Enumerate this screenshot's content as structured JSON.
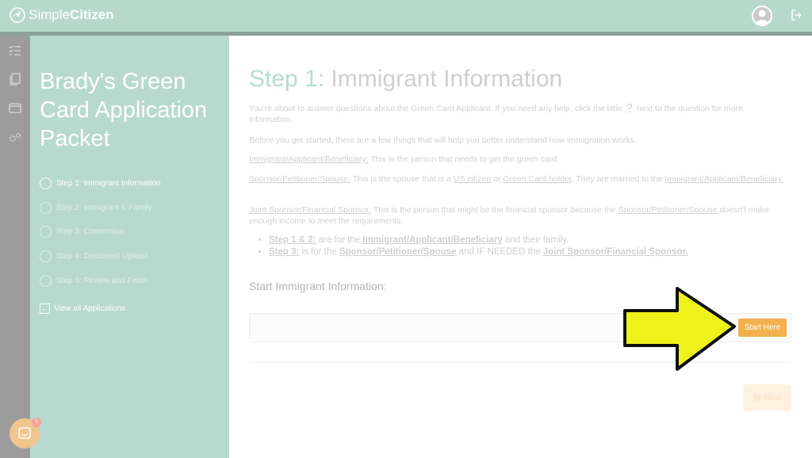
{
  "brand": {
    "name_light": "Simple",
    "name_bold": "Citizen"
  },
  "sidebar": {
    "packet_title": "Brady's Green Card Application Packet",
    "steps": [
      {
        "label": "Step 1: Immigrant Information"
      },
      {
        "label": "Step 2: Immigrant & Family"
      },
      {
        "label": "Step 3: Connection"
      },
      {
        "label": "Step 4: Document Upload"
      },
      {
        "label": "Step 5: Review and Finish"
      }
    ],
    "view_all": "View all Applications"
  },
  "chat": {
    "badge": "1"
  },
  "main": {
    "title_step": "Step 1:",
    "title_text": "Immigrant Information",
    "intro_1": "You're about to answer questions about the Green Card Applicant. If you need any help, click the little",
    "intro_2": "next to the question for more information.",
    "intro_get_started": "Before you get started, there are a few things that will help you better understand how immigration works.",
    "def1_term": "Immigrant/Applicant/Beneficiary:",
    "def1_text": "This is the person that needs to get the green card.",
    "def2_term": "Sponsor/Petitioner/Spouse:",
    "def2_text_a": "This is the spouse that is a",
    "def2_us": "US citizen",
    "def2_or": "or",
    "def2_gc": "Green Card holder",
    "def2_text_b": ". They are married to the",
    "def2_term2": "Immigrant/Applicant/Beneficiary.",
    "def3_term": "Joint Sponsor/Financial Sponsor:",
    "def3_text_a": "This is the person that might be the financial sponsor because the",
    "def3_term2": "Sponsor/Petitioner/Spouse",
    "def3_text_b": "doesn't make enough income to meet the requirements.",
    "b1_key": "Step 1 & 2:",
    "b1_a": "are for the",
    "b1_term": "Immigrant/Applicant/Beneficiary",
    "b1_b": "and their family.",
    "b2_key": "Step 3:",
    "b2_a": "is for the",
    "b2_term": "Sponsor/Petitioner/Spouse",
    "b2_b": "and IF NEEDED the",
    "b2_term2": "Joint Sponsor/Financial Sponsor.",
    "section_title": "Start Immigrant Information:",
    "start_button": "Start Here",
    "next_button": "Next"
  },
  "colors": {
    "accent": "#b6d9cc",
    "button": "#f3b04f",
    "arrow": "#eef21a"
  }
}
